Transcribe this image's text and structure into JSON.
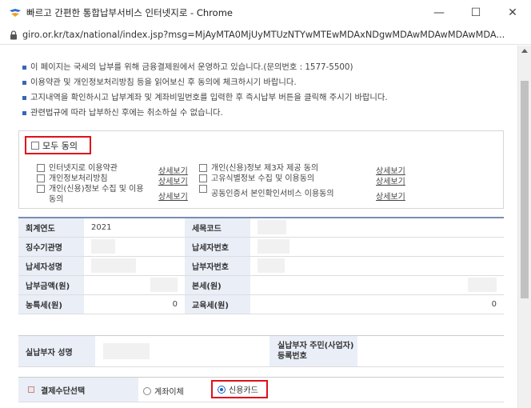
{
  "window": {
    "title": "빠르고 간편한 통합납부서비스 인터넷지로 - Chrome",
    "controls": {
      "minimize": "—",
      "maximize": "☐",
      "close": "✕"
    }
  },
  "address": {
    "url": "giro.or.kr/tax/national/index.jsp?msg=MjAyMTA0MjUyMTUzNTYwMTEwMDAxNDgwMDAwMDAwMDAwMDA..."
  },
  "notices": [
    "이 페이지는 국세의 납부를 위해 금융결제원에서 운영하고 있습니다.(문의번호 : 1577-5500)",
    "이용약관 및 개인정보처리방침 등을 읽어보신 후 동의에 체크하시기 바랍니다.",
    "고지내역을 확인하시고 납부계좌 및 계좌비밀번호를 입력한 후 즉시납부 버튼을 클릭해 주시기 바랍니다.",
    "관련법규에 따라 납부하신 후에는 취소하실 수 없습니다."
  ],
  "agreement": {
    "all_label": "모두 동의",
    "terms_left": [
      {
        "label": "인터넷지로 이용약관",
        "link": "상세보기"
      },
      {
        "label": "개인정보처리방침",
        "link": "상세보기"
      },
      {
        "label_l1": "개인(신용)정보 수집 및 이용",
        "label_l2": "동의",
        "link": "상세보기"
      }
    ],
    "terms_right": [
      {
        "label": "개인(신용)정보 제3자 제공 동의",
        "link": "상세보기"
      },
      {
        "label": "고유식별정보 수집 및 이용동의",
        "link": "상세보기"
      },
      {
        "label": "공동인증서 본인확인서비스 이용동의",
        "link": "상세보기"
      }
    ]
  },
  "tax_info": {
    "rows": [
      {
        "label1": "회계연도",
        "value1": "2021",
        "label2": "세목코드",
        "value2": ""
      },
      {
        "label1": "징수기관명",
        "value1": "",
        "label2": "납세자번호",
        "value2": ""
      },
      {
        "label1": "납세자성명",
        "value1": "",
        "label2": "납부자번호",
        "value2": ""
      },
      {
        "label1": "납부금액(원)",
        "value1": "",
        "label2": "본세(원)",
        "value2": ""
      },
      {
        "label1": "농특세(원)",
        "value1": "0",
        "label2": "교육세(원)",
        "value2": "0"
      }
    ]
  },
  "payer": {
    "name_label": "실납부자 성명",
    "id_label_l1": "실납부자 주민(사업자)",
    "id_label_l2": "등록번호"
  },
  "payment_method": {
    "label": "결제수단선택",
    "option_account": "계좌이체",
    "option_card": "신용카드",
    "selected": "신용카드"
  },
  "colors": {
    "accent_red": "#e0101a",
    "header_bg": "#e9eef7",
    "bullet_blue": "#3966b5"
  }
}
